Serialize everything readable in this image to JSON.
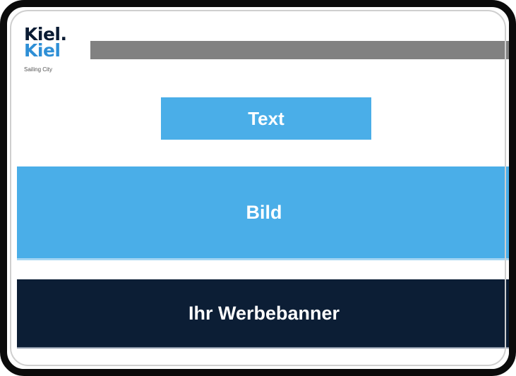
{
  "logo": {
    "line1": "Kiel.",
    "line2": "Kiel",
    "tagline": "Sailing City"
  },
  "text_button": {
    "label": "Text"
  },
  "image_block": {
    "label": "Bild"
  },
  "ad_banner": {
    "label": "Ihr Werbebanner"
  },
  "colors": {
    "accent_blue": "#4aaee8",
    "banner_navy": "#0c1e35",
    "header_bar_gray": "#818181",
    "logo_navy": "#0a1b33",
    "logo_blue": "#2e8fd6"
  }
}
